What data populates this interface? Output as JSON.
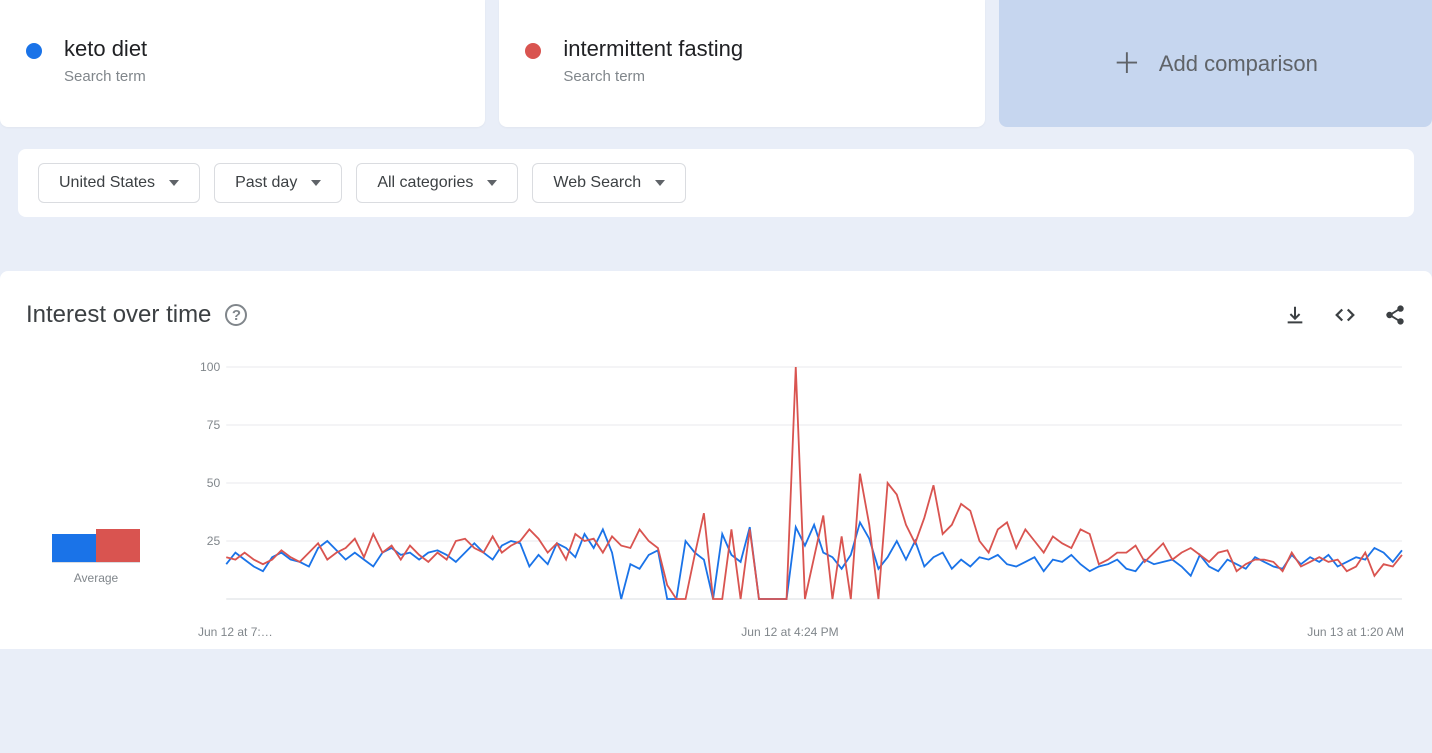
{
  "terms": [
    {
      "name": "keto diet",
      "subtitle": "Search term",
      "color": "#1a73e8"
    },
    {
      "name": "intermittent fasting",
      "subtitle": "Search term",
      "color": "#d95450"
    }
  ],
  "add_comparison_label": "Add comparison",
  "filters": {
    "region": "United States",
    "time": "Past day",
    "category": "All categories",
    "search_type": "Web Search"
  },
  "chart": {
    "title": "Interest over time",
    "avg_label": "Average",
    "x_labels": [
      "Jun 12 at 7:…",
      "Jun 12 at 4:24 PM",
      "Jun 13 at 1:20 AM"
    ]
  },
  "chart_data": {
    "type": "line",
    "ylabel": "",
    "xlabel": "",
    "ylim": [
      0,
      100
    ],
    "yticks": [
      25,
      50,
      75,
      100
    ],
    "averages": {
      "keto diet": 16,
      "intermittent fasting": 19
    },
    "series": [
      {
        "name": "keto diet",
        "color": "#1a73e8",
        "values": [
          15,
          20,
          17,
          14,
          12,
          18,
          20,
          17,
          16,
          14,
          22,
          25,
          21,
          17,
          20,
          17,
          14,
          20,
          22,
          19,
          20,
          17,
          20,
          21,
          19,
          16,
          20,
          24,
          20,
          17,
          23,
          25,
          24,
          14,
          19,
          15,
          24,
          22,
          18,
          28,
          22,
          30,
          20,
          0,
          15,
          13,
          19,
          21,
          0,
          0,
          25,
          20,
          17,
          0,
          28,
          19,
          16,
          31,
          0,
          0,
          0,
          0,
          31,
          23,
          32,
          20,
          18,
          13,
          19,
          33,
          26,
          13,
          18,
          25,
          17,
          25,
          14,
          18,
          20,
          13,
          17,
          14,
          18,
          17,
          19,
          15,
          14,
          16,
          18,
          12,
          17,
          16,
          19,
          15,
          12,
          14,
          15,
          17,
          13,
          12,
          17,
          15,
          16,
          17,
          14,
          10,
          19,
          14,
          12,
          17,
          15,
          13,
          18,
          16,
          14,
          13,
          19,
          15,
          18,
          16,
          19,
          14,
          16,
          18,
          17,
          22,
          20,
          16,
          21
        ]
      },
      {
        "name": "intermittent fasting",
        "color": "#d95450",
        "values": [
          18,
          17,
          20,
          17,
          15,
          17,
          21,
          18,
          16,
          20,
          24,
          17,
          20,
          22,
          26,
          18,
          28,
          20,
          23,
          17,
          23,
          19,
          16,
          20,
          17,
          25,
          26,
          22,
          20,
          27,
          20,
          23,
          25,
          30,
          26,
          20,
          24,
          17,
          28,
          25,
          26,
          20,
          27,
          23,
          22,
          30,
          25,
          22,
          6,
          0,
          0,
          19,
          37,
          0,
          0,
          30,
          0,
          30,
          0,
          0,
          0,
          0,
          100,
          0,
          18,
          36,
          0,
          27,
          0,
          54,
          32,
          0,
          50,
          45,
          32,
          24,
          35,
          49,
          28,
          32,
          41,
          38,
          25,
          20,
          30,
          33,
          22,
          30,
          25,
          20,
          27,
          24,
          22,
          30,
          28,
          15,
          17,
          20,
          20,
          23,
          16,
          20,
          24,
          17,
          20,
          22,
          19,
          16,
          20,
          21,
          12,
          15,
          17,
          17,
          16,
          12,
          20,
          14,
          16,
          18,
          16,
          17,
          12,
          14,
          20,
          10,
          15,
          14,
          19
        ]
      }
    ]
  }
}
